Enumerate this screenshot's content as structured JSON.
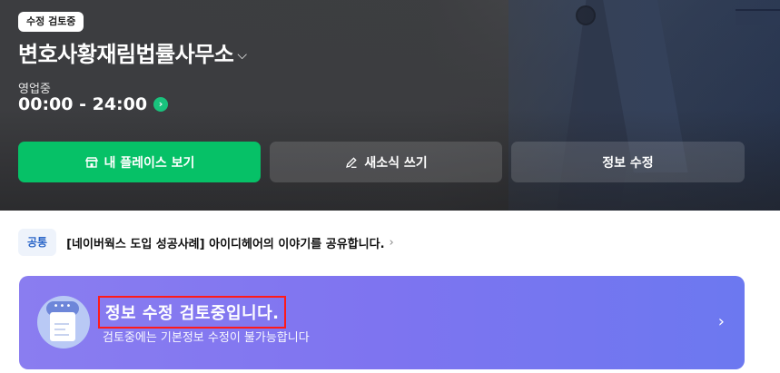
{
  "hero": {
    "badge": "수정 검토중",
    "business_name": "변호사황재림법률사무소",
    "status": "영업중",
    "hours": "00:00 - 24:00"
  },
  "actions": {
    "my_place_label": "내 플레이스 보기",
    "write_news_label": "새소식 쓰기",
    "edit_info_label": "정보 수정"
  },
  "notice": {
    "tag": "공통",
    "text": "[네이버웍스 도입 성공사례] 아이디헤어의 이야기를 공유합니다."
  },
  "banner": {
    "title": "정보 수정 검토중입니다.",
    "subtitle": "검토중에는 기본정보 수정이 불가능합니다"
  },
  "colors": {
    "primary_green": "#06c167",
    "banner_purple": "#7e74f0",
    "highlight_red": "#ff1a1a"
  }
}
